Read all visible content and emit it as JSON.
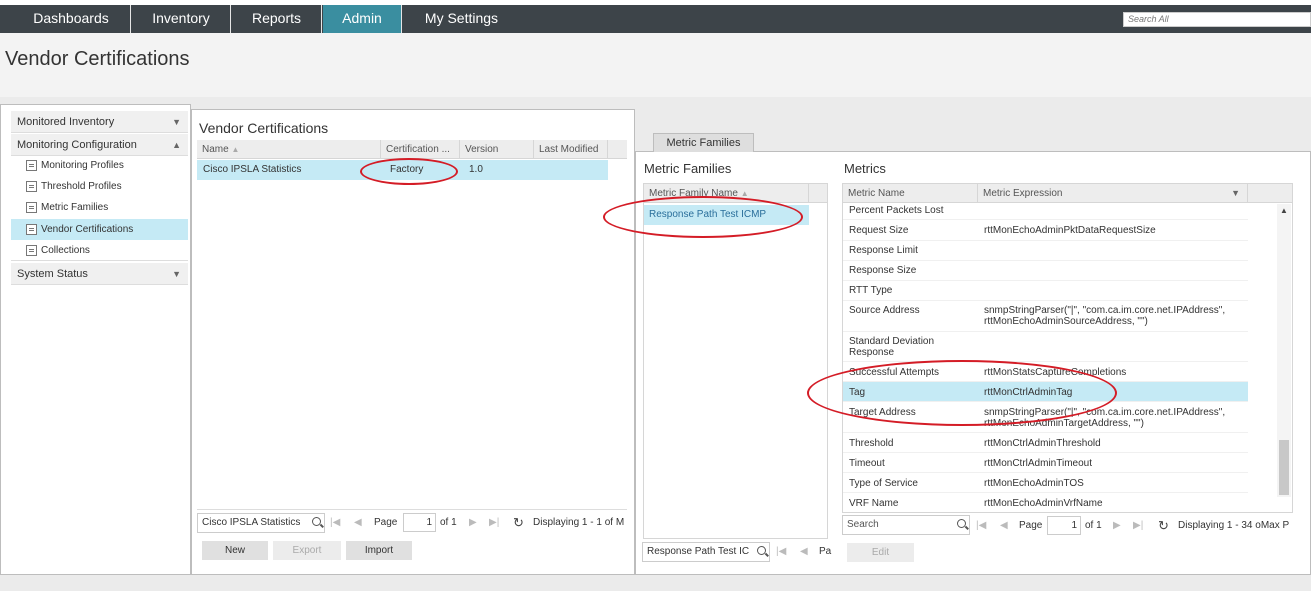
{
  "nav": {
    "tabs": [
      "Dashboards",
      "Inventory",
      "Reports",
      "Admin",
      "My Settings"
    ],
    "active_tab": "Admin",
    "search_placeholder": "Search All"
  },
  "page_title": "Vendor Certifications",
  "sidebar": {
    "sections": {
      "monitored_inventory": "Monitored Inventory",
      "monitoring_configuration": "Monitoring Configuration",
      "system_status": "System Status"
    },
    "items": [
      "Monitoring Profiles",
      "Threshold Profiles",
      "Metric Families",
      "Vendor Certifications",
      "Collections"
    ],
    "selected": "Vendor Certifications"
  },
  "vendor_certs": {
    "title": "Vendor Certifications",
    "columns": [
      "Name",
      "Certification ...",
      "Version",
      "Last Modified"
    ],
    "rows": [
      {
        "name": "Cisco IPSLA Statistics",
        "certification": "Factory",
        "version": "1.0",
        "last_modified": ""
      }
    ],
    "search_value": "Cisco IPSLA Statistics",
    "pager": {
      "page_label": "Page",
      "page": "1",
      "of_label": "of 1",
      "displaying": "Displaying 1 - 1 of M"
    },
    "buttons": {
      "new": "New",
      "export": "Export",
      "import": "Import"
    }
  },
  "metric_families_tab": "Metric Families",
  "metric_families": {
    "title": "Metric Families",
    "column": "Metric Family Name",
    "rows": [
      "Response Path Test ICMP"
    ],
    "search_value": "Response Path Test IC",
    "pager_fragment": "Pa"
  },
  "metrics": {
    "title": "Metrics",
    "columns": [
      "Metric Name",
      "Metric Expression"
    ],
    "rows": [
      {
        "name": "Percent Packets Lost",
        "expression": ""
      },
      {
        "name": "Request Size",
        "expression": "rttMonEchoAdminPktDataRequestSize"
      },
      {
        "name": "Response Limit",
        "expression": ""
      },
      {
        "name": "Response Size",
        "expression": ""
      },
      {
        "name": "RTT Type",
        "expression": ""
      },
      {
        "name": "Source Address",
        "expression": "snmpStringParser(\"|\", \"com.ca.im.core.net.IPAddress\", rttMonEchoAdminSourceAddress, \"\")"
      },
      {
        "name": "Standard Deviation Response",
        "expression": ""
      },
      {
        "name": "Successful Attempts",
        "expression": "rttMonStatsCaptureCompletions"
      },
      {
        "name": "Tag",
        "expression": "rttMonCtrlAdminTag"
      },
      {
        "name": "Target Address",
        "expression": "snmpStringParser(\"|\", \"com.ca.im.core.net.IPAddress\", rttMonEchoAdminTargetAddress, \"\")"
      },
      {
        "name": "Threshold",
        "expression": "rttMonCtrlAdminThreshold"
      },
      {
        "name": "Timeout",
        "expression": "rttMonCtrlAdminTimeout"
      },
      {
        "name": "Type of Service",
        "expression": "rttMonEchoAdminTOS"
      },
      {
        "name": "VRF Name",
        "expression": "rttMonEchoAdminVrfName"
      }
    ],
    "selected_row": "Tag",
    "search_placeholder": "Search",
    "pager": {
      "page_label": "Page",
      "page": "1",
      "of_label": "of 1",
      "displaying": "Displaying 1 - 34 oMax P"
    },
    "edit_button": "Edit"
  },
  "annotation_color": "#d41c26",
  "accent_color": "#3a8ea0",
  "selection_color": "#c5eaf5"
}
